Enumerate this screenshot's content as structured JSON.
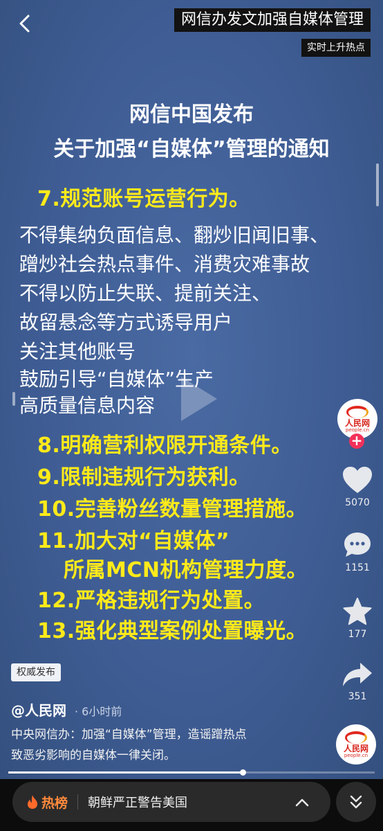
{
  "header": {
    "back_icon": "chevron-left-icon",
    "hot_title": "网信办发文加强自媒体管理",
    "hot_subtitle": "实时上升热点"
  },
  "video": {
    "headline_1": "网信中国发布",
    "headline_2": "关于加强“自媒体”管理的通知",
    "item_7": "7.规范账号运营行为。",
    "body_lines": [
      "不得集纳负面信息、翻炒旧闻旧事、",
      "蹭炒社会热点事件、消费灾难事故",
      "不得以防止失联、提前关注、",
      "故留悬念等方式诱导用户",
      "关注其他账号",
      "鼓励引导“自媒体”生产",
      "高质量信息内容"
    ],
    "items": [
      "8.明确营利权限开通条件。",
      "9.限制违规行为获利。",
      "10.完善粉丝数量管理措施。",
      "11.加大对“自媒体”",
      "所属MCN机构管理力度。",
      "12.严格违规行为处置。",
      "13.强化典型案例处置曝光。"
    ],
    "text_color": "#ffea1a",
    "background_color": "#3f5d94"
  },
  "sidebar": {
    "avatar_logo_cn": "人民网",
    "avatar_logo_en": "people.cn",
    "follow_symbol": "+",
    "like_icon": "heart-icon",
    "like_count": "5070",
    "comment_icon": "comment-icon",
    "comment_count": "1151",
    "favorite_icon": "star-icon",
    "favorite_count": "177",
    "share_icon": "share-arrow-icon",
    "share_count": "351",
    "music_disc_icon": "music-disc-icon"
  },
  "info": {
    "badge": "权威发布",
    "author": "@人民网",
    "time": "· 6小时前",
    "description_1": "中央网信办：加强“自媒体”管理，造谣蹭热点",
    "description_2": "致恶劣影响的自媒体一律关闭。"
  },
  "progress": {
    "fraction": 0.64
  },
  "bottom_bar": {
    "hot_label": "热榜",
    "flame_icon": "flame-icon",
    "hot_text": "朝鲜严正警告美国",
    "expand_icon": "chevron-up-icon",
    "collapse_icon": "double-chevron-down-icon",
    "accent_color": "#ff8a3d"
  }
}
